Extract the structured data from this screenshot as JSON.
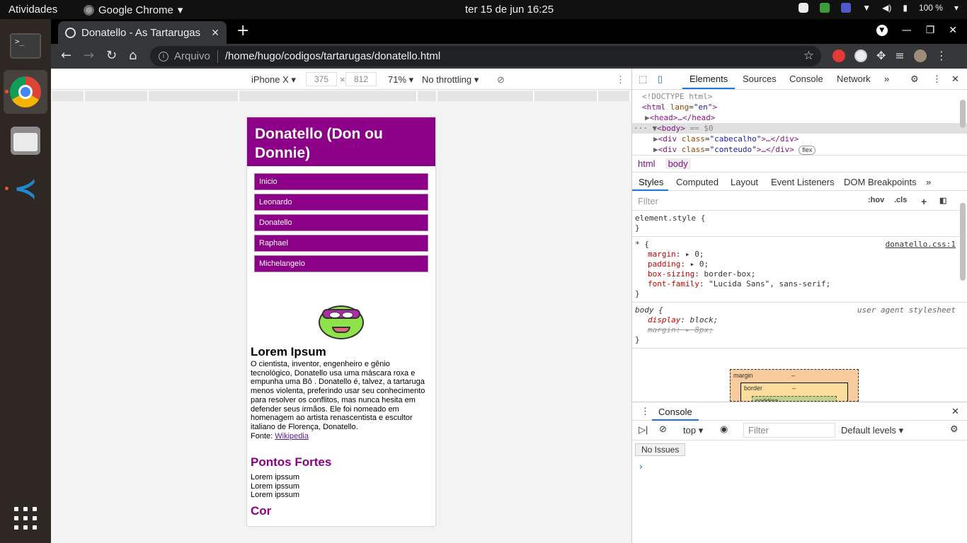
{
  "topbar": {
    "activities": "Atividades",
    "app_name": "Google Chrome",
    "clock": "ter 15 de jun  16:25",
    "battery": "100 %"
  },
  "dock": {
    "items": [
      "terminal-icon",
      "chrome-icon",
      "files-icon",
      "vscode-icon"
    ],
    "accent": "#e95420"
  },
  "browser": {
    "tab_title": "Donatello - As Tartarugas",
    "url_prefix": "Arquivo",
    "url": "/home/hugo/codigos/tartarugas/donatello.html"
  },
  "device_toolbar": {
    "device": "iPhone X",
    "width": "375",
    "height": "812",
    "zoom": "71%",
    "throttling": "No throttling"
  },
  "page": {
    "header": "Donatello (Don ou Donnie)",
    "menu": [
      "Inicio",
      "Leonardo",
      "Donatello",
      "Raphael",
      "Michelangelo"
    ],
    "article_title": "Lorem Ipsum",
    "article_text": "O cientista, inventor, engenheiro e gênio tecnológico, Donatello usa uma máscara roxa e empunha uma Bô . Donatello é, talvez, a tartaruga menos violenta, preferindo usar seu conhecimento para resolver os conflitos, mas nunca hesita em defender seus irmãos. Ele foi nomeado em homenagem ao artista renascentista e escultor italiano de Florença, Donatello.",
    "source_label": "Fonte: ",
    "source_link": "Wikipedia",
    "strengths_title": "Pontos Fortes",
    "strengths": [
      "Lorem ipssum",
      "Lorem ipssum",
      "Lorem ipssum"
    ],
    "color_title": "Cor",
    "brand_color": "#8b0086"
  },
  "devtools": {
    "tabs": [
      "Elements",
      "Sources",
      "Console",
      "Network"
    ],
    "dom": {
      "doctype": "<!DOCTYPE html>",
      "html_open": "<html",
      "lang_attr": "lang",
      "lang_val": "\"en\"",
      "head": "<head>…</head>",
      "body": "<body>",
      "body_eq": "== $0",
      "div1_class": "\"cabecalho\"",
      "div2_class": "\"conteudo\"",
      "flex_badge": "flex"
    },
    "breadcrumbs": [
      "html",
      "body"
    ],
    "style_tabs": [
      "Styles",
      "Computed",
      "Layout",
      "Event Listeners",
      "DOM Breakpoints"
    ],
    "filter_placeholder": "Filter",
    "hov": ":hov",
    "cls": ".cls",
    "rules": {
      "element_style": "element.style {",
      "universal_selector": "* {",
      "universal_source": "donatello.css:1",
      "margin": "margin",
      "margin_val": "0;",
      "padding": "padding",
      "padding_val": "0;",
      "box_sizing": "box-sizing",
      "box_sizing_val": "border-box;",
      "font_family": "font-family",
      "font_family_val": "\"Lucida Sans\", sans-serif;",
      "body_selector": "body {",
      "ua_label": "user agent stylesheet",
      "display": "display",
      "display_val": "block;",
      "body_margin": "margin",
      "body_margin_val": "8px;",
      "close": "}"
    },
    "boxmodel": {
      "margin": "margin",
      "border": "border",
      "padding": "padding",
      "dash": "–"
    },
    "console": {
      "title": "Console",
      "context": "top",
      "filter": "Filter",
      "levels": "Default levels",
      "issues": "No Issues"
    }
  }
}
